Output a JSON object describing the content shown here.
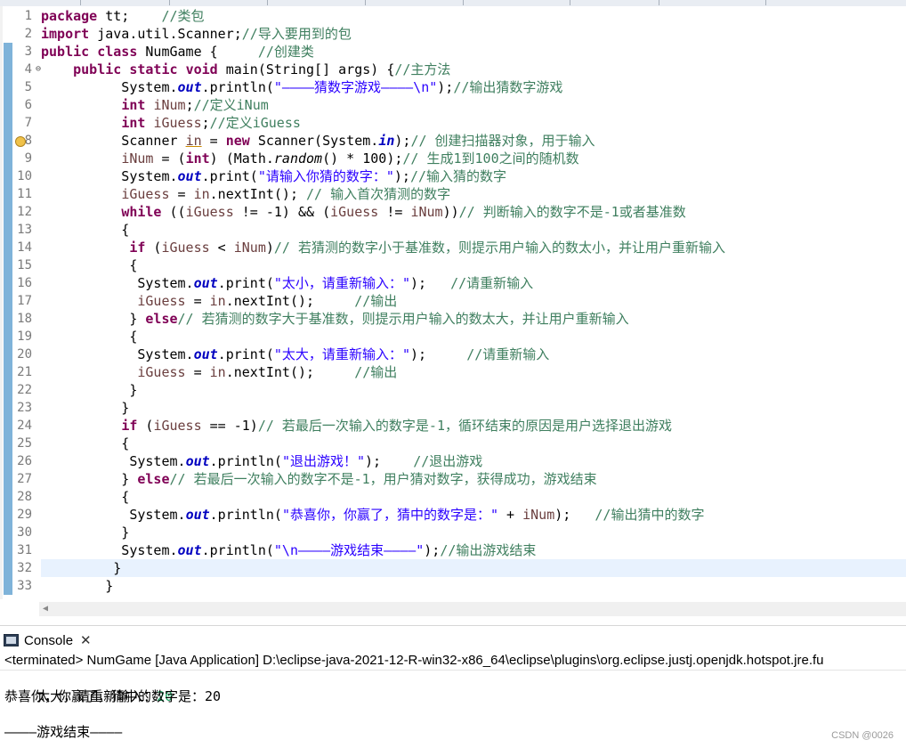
{
  "tabs": [
    "",
    "",
    "",
    "",
    "",
    "",
    "",
    "",
    "",
    ""
  ],
  "editor": {
    "line_numbers": [
      "1",
      "2",
      "3",
      "4",
      "5",
      "6",
      "7",
      "8",
      "9",
      "10",
      "11",
      "12",
      "13",
      "14",
      "15",
      "16",
      "17",
      "18",
      "19",
      "20",
      "21",
      "22",
      "23",
      "24",
      "25",
      "26",
      "27",
      "28",
      "29",
      "30",
      "31",
      "32",
      "33"
    ],
    "lines": [
      [
        {
          "t": "package",
          "c": "kw"
        },
        {
          "t": " tt;    "
        },
        {
          "t": "//类包",
          "c": "cm"
        }
      ],
      [
        {
          "t": "import",
          "c": "kw"
        },
        {
          "t": " java.util.Scanner;"
        },
        {
          "t": "//导入要用到的包",
          "c": "cm"
        }
      ],
      [
        {
          "t": "public",
          "c": "kw"
        },
        {
          "t": " "
        },
        {
          "t": "class",
          "c": "kw"
        },
        {
          "t": " NumGame {     "
        },
        {
          "t": "//创建类",
          "c": "cm"
        }
      ],
      [
        {
          "t": "    "
        },
        {
          "t": "public",
          "c": "kw"
        },
        {
          "t": " "
        },
        {
          "t": "static",
          "c": "kw"
        },
        {
          "t": " "
        },
        {
          "t": "void",
          "c": "kw"
        },
        {
          "t": " main(String[] args) {"
        },
        {
          "t": "//主方法",
          "c": "cm"
        }
      ],
      [
        {
          "t": "          System."
        },
        {
          "t": "out",
          "c": "fd"
        },
        {
          "t": ".println("
        },
        {
          "t": "\"————猜数字游戏————\\n\"",
          "c": "st"
        },
        {
          "t": ");"
        },
        {
          "t": "//输出猜数字游戏",
          "c": "cm"
        }
      ],
      [
        {
          "t": "          "
        },
        {
          "t": "int",
          "c": "kw"
        },
        {
          "t": " "
        },
        {
          "t": "iNum",
          "c": "vr"
        },
        {
          "t": ";"
        },
        {
          "t": "//定义iNum",
          "c": "cm"
        }
      ],
      [
        {
          "t": "          "
        },
        {
          "t": "int",
          "c": "kw"
        },
        {
          "t": " "
        },
        {
          "t": "iGuess",
          "c": "vr"
        },
        {
          "t": ";"
        },
        {
          "t": "//定义iGuess",
          "c": "cm"
        }
      ],
      [
        {
          "t": "          Scanner "
        },
        {
          "t": "in",
          "c": "vr un"
        },
        {
          "t": " = "
        },
        {
          "t": "new",
          "c": "kw"
        },
        {
          "t": " Scanner(System."
        },
        {
          "t": "in",
          "c": "fd"
        },
        {
          "t": ");"
        },
        {
          "t": "// 创建扫描器对象，用于输入",
          "c": "cm"
        }
      ],
      [
        {
          "t": "          "
        },
        {
          "t": "iNum",
          "c": "vr"
        },
        {
          "t": " = ("
        },
        {
          "t": "int",
          "c": "kw"
        },
        {
          "t": ") (Math."
        },
        {
          "t": "random",
          "c": "mt"
        },
        {
          "t": "() * 100);"
        },
        {
          "t": "// 生成1到100之间的随机数",
          "c": "cm"
        }
      ],
      [
        {
          "t": "          System."
        },
        {
          "t": "out",
          "c": "fd"
        },
        {
          "t": ".print("
        },
        {
          "t": "\"请输入你猜的数字：\"",
          "c": "st"
        },
        {
          "t": ");"
        },
        {
          "t": "//输入猜的数字",
          "c": "cm"
        }
      ],
      [
        {
          "t": "          "
        },
        {
          "t": "iGuess",
          "c": "vr"
        },
        {
          "t": " = "
        },
        {
          "t": "in",
          "c": "vr"
        },
        {
          "t": ".nextInt(); "
        },
        {
          "t": "// 输入首次猜测的数字",
          "c": "cm"
        }
      ],
      [
        {
          "t": "          "
        },
        {
          "t": "while",
          "c": "kw"
        },
        {
          "t": " (("
        },
        {
          "t": "iGuess",
          "c": "vr"
        },
        {
          "t": " != -1) && ("
        },
        {
          "t": "iGuess",
          "c": "vr"
        },
        {
          "t": " != "
        },
        {
          "t": "iNum",
          "c": "vr"
        },
        {
          "t": "))"
        },
        {
          "t": "// 判断输入的数字不是-1或者基准数",
          "c": "cm"
        }
      ],
      [
        {
          "t": "          {"
        }
      ],
      [
        {
          "t": "           "
        },
        {
          "t": "if",
          "c": "kw"
        },
        {
          "t": " ("
        },
        {
          "t": "iGuess",
          "c": "vr"
        },
        {
          "t": " < "
        },
        {
          "t": "iNum",
          "c": "vr"
        },
        {
          "t": ")"
        },
        {
          "t": "// 若猜测的数字小于基准数，则提示用户输入的数太小，并让用户重新输入",
          "c": "cm"
        }
      ],
      [
        {
          "t": "           {"
        }
      ],
      [
        {
          "t": "            System."
        },
        {
          "t": "out",
          "c": "fd"
        },
        {
          "t": ".print("
        },
        {
          "t": "\"太小，请重新输入：\"",
          "c": "st"
        },
        {
          "t": ");   "
        },
        {
          "t": "//请重新输入",
          "c": "cm"
        }
      ],
      [
        {
          "t": "            "
        },
        {
          "t": "iGuess",
          "c": "vr"
        },
        {
          "t": " = "
        },
        {
          "t": "in",
          "c": "vr"
        },
        {
          "t": ".nextInt();     "
        },
        {
          "t": "//输出",
          "c": "cm"
        }
      ],
      [
        {
          "t": "           } "
        },
        {
          "t": "else",
          "c": "kw"
        },
        {
          "t": "// 若猜测的数字大于基准数，则提示用户输入的数太大，并让用户重新输入",
          "c": "cm"
        }
      ],
      [
        {
          "t": "           {"
        }
      ],
      [
        {
          "t": "            System."
        },
        {
          "t": "out",
          "c": "fd"
        },
        {
          "t": ".print("
        },
        {
          "t": "\"太大，请重新输入：\"",
          "c": "st"
        },
        {
          "t": ");     "
        },
        {
          "t": "//请重新输入",
          "c": "cm"
        }
      ],
      [
        {
          "t": "            "
        },
        {
          "t": "iGuess",
          "c": "vr"
        },
        {
          "t": " = "
        },
        {
          "t": "in",
          "c": "vr"
        },
        {
          "t": ".nextInt();     "
        },
        {
          "t": "//输出",
          "c": "cm"
        }
      ],
      [
        {
          "t": "           }"
        }
      ],
      [
        {
          "t": "          }"
        }
      ],
      [
        {
          "t": "          "
        },
        {
          "t": "if",
          "c": "kw"
        },
        {
          "t": " ("
        },
        {
          "t": "iGuess",
          "c": "vr"
        },
        {
          "t": " == -1)"
        },
        {
          "t": "// 若最后一次输入的数字是-1，循环结束的原因是用户选择退出游戏",
          "c": "cm"
        }
      ],
      [
        {
          "t": "          {"
        }
      ],
      [
        {
          "t": "           System."
        },
        {
          "t": "out",
          "c": "fd"
        },
        {
          "t": ".println("
        },
        {
          "t": "\"退出游戏！\"",
          "c": "st"
        },
        {
          "t": ");    "
        },
        {
          "t": "//退出游戏",
          "c": "cm"
        }
      ],
      [
        {
          "t": "          } "
        },
        {
          "t": "else",
          "c": "kw"
        },
        {
          "t": "// 若最后一次输入的数字不是-1，用户猜对数字，获得成功，游戏结束",
          "c": "cm"
        }
      ],
      [
        {
          "t": "          {"
        }
      ],
      [
        {
          "t": "           System."
        },
        {
          "t": "out",
          "c": "fd"
        },
        {
          "t": ".println("
        },
        {
          "t": "\"恭喜你，你赢了，猜中的数字是：\"",
          "c": "st"
        },
        {
          "t": " + "
        },
        {
          "t": "iNum",
          "c": "vr"
        },
        {
          "t": ");   "
        },
        {
          "t": "//输出猜中的数字",
          "c": "cm"
        }
      ],
      [
        {
          "t": "          }"
        }
      ],
      [
        {
          "t": "          System."
        },
        {
          "t": "out",
          "c": "fd"
        },
        {
          "t": ".println("
        },
        {
          "t": "\"\\n————游戏结束————\"",
          "c": "st"
        },
        {
          "t": ");"
        },
        {
          "t": "//输出游戏结束",
          "c": "cm"
        }
      ],
      [
        {
          "t": "         }"
        }
      ],
      [
        {
          "t": "        }"
        }
      ]
    ]
  },
  "console": {
    "tab_label": "Console",
    "close_glyph": "✕",
    "terminated_line": "<terminated> NumGame [Java Application] D:\\eclipse-java-2021-12-R-win32-x86_64\\eclipse\\plugins\\org.eclipse.justj.openjdk.hotspot.jre.fu",
    "output_line1_prompt": "太大，请重新输入：",
    "output_line1_input": "20",
    "output_line2": "恭喜你，你赢了，猜中的数字是：20",
    "output_line3": "",
    "output_line4": "————游戏结束————"
  },
  "watermark": "CSDN @0026"
}
